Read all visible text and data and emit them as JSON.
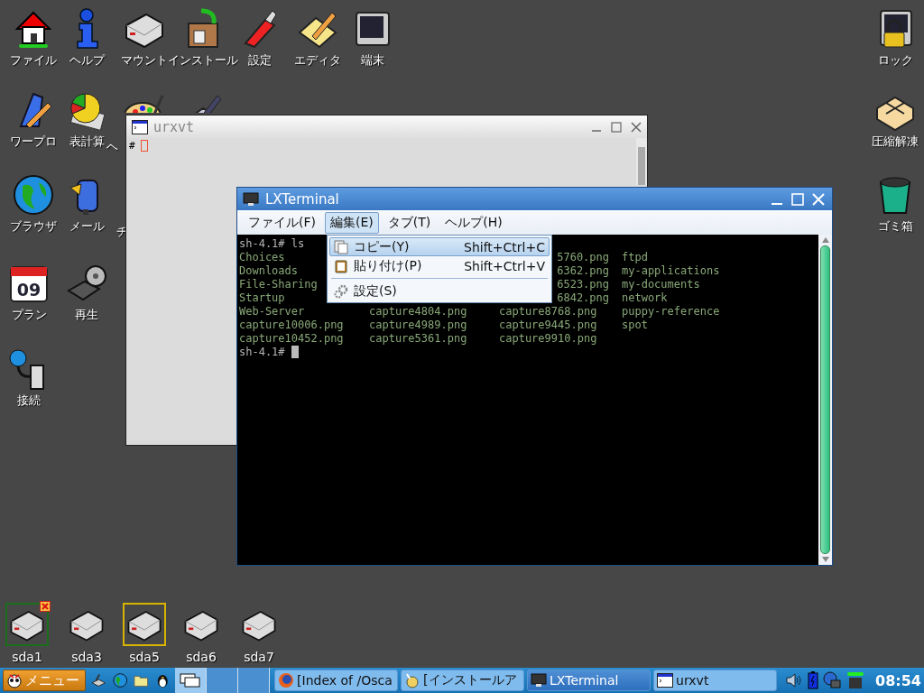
{
  "desktop_icons": [
    {
      "label": "ファイル",
      "kind": "house"
    },
    {
      "label": "ヘルプ",
      "kind": "info"
    },
    {
      "label": "マウント",
      "kind": "drive"
    },
    {
      "label": "インストール",
      "kind": "package"
    },
    {
      "label": "設定",
      "kind": "knife"
    },
    {
      "label": "エディタ",
      "kind": "notepad"
    },
    {
      "label": "端末",
      "kind": "monitor"
    },
    {
      "label": "ワープロ",
      "kind": "pencil"
    },
    {
      "label": "表計算",
      "kind": "pie"
    },
    {
      "label": "ヘ",
      "kind": "palette"
    },
    {
      "kind": "drawing"
    },
    {
      "label": "ブラウザ",
      "kind": "globe"
    },
    {
      "label": "メール",
      "kind": "mailbox"
    },
    {
      "label": "チ",
      "kind": "hidden"
    },
    {
      "label": "プラン",
      "kind": "calendar",
      "day": "09"
    },
    {
      "label": "再生",
      "kind": "projector"
    },
    {
      "label": "接続",
      "kind": "network"
    },
    {
      "label": "ロック",
      "kind": "lock"
    },
    {
      "label": "圧縮解凍",
      "kind": "gift"
    },
    {
      "label": "ゴミ箱",
      "kind": "trash"
    }
  ],
  "drives": [
    {
      "label": "sda1",
      "color": "#1b6e1b",
      "unmount_badge": true
    },
    {
      "label": "sda3",
      "unmount_badge": false
    },
    {
      "label": "sda5",
      "color": "#d8b400",
      "unmount_badge": false
    },
    {
      "label": "sda6",
      "unmount_badge": false
    },
    {
      "label": "sda7",
      "unmount_badge": false
    }
  ],
  "urxvt": {
    "title": "urxvt",
    "prompt": "#"
  },
  "lxterminal": {
    "title": "LXTerminal",
    "menu": [
      {
        "label": "ファイル(F)",
        "selected": false
      },
      {
        "label": "編集(E)",
        "selected": true
      },
      {
        "label": "タブ(T)",
        "selected": false
      },
      {
        "label": "ヘルプ(H)",
        "selected": false
      }
    ],
    "command_line": "sh-4.1# ls",
    "rows": [
      {
        "column_1": "Choices",
        "column_3": "5760.png",
        "column_4": "ftpd"
      },
      {
        "column_1": "Downloads",
        "column_3": "6362.png",
        "column_4": "my-applications"
      },
      {
        "column_1": "File-Sharing",
        "column_3": "6523.png",
        "column_4": "my-documents"
      },
      {
        "column_1": "Startup",
        "column_3": "6842.png",
        "column_4": "network"
      },
      {
        "column_1": "Web-Server",
        "column_2": "capture4804.png",
        "column_3": "capture8768.png",
        "column_4": "puppy-reference"
      },
      {
        "column_1": "capture10006.png",
        "column_2": "capture4989.png",
        "column_3": "capture9445.png",
        "column_4": "spot"
      },
      {
        "column_1": "capture10452.png",
        "column_2": "capture5361.png",
        "column_3": "capture9910.png"
      }
    ],
    "prompt": "sh-4.1#",
    "dropdown": [
      {
        "kind": "item",
        "label": "コピー(Y)",
        "shortcut": "Shift+Ctrl+C",
        "selected": true
      },
      {
        "kind": "item",
        "label": "貼り付け(P)",
        "shortcut": "Shift+Ctrl+V",
        "selected": false
      },
      {
        "kind": "separator"
      },
      {
        "kind": "item",
        "label": "設定(S)",
        "selected": false
      }
    ]
  },
  "taskbar": {
    "menu_label": "メニュー",
    "tasks": [
      {
        "label": "[Index of /Osca",
        "active": false
      },
      {
        "label": "[インストールア",
        "active": false
      },
      {
        "label": "LXTerminal",
        "active": true
      },
      {
        "label": "urxvt",
        "active": false
      }
    ],
    "clock": "08:54"
  }
}
